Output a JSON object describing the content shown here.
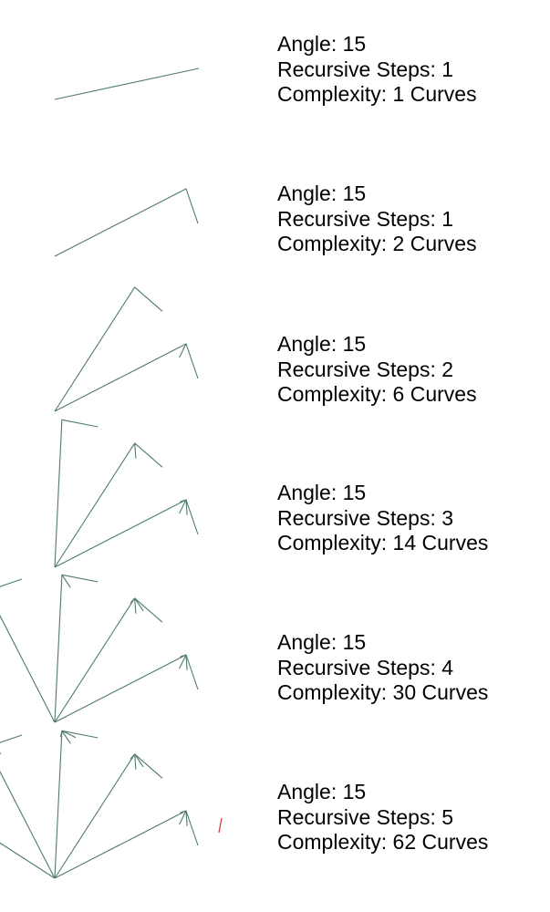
{
  "panels": [
    {
      "angle": "Angle: 15",
      "steps": "Recursive Steps: 1",
      "complexity": "Complexity: 1 Curves",
      "recursion_depth": 0
    },
    {
      "angle": "Angle: 15",
      "steps": "Recursive Steps: 1",
      "complexity": "Complexity: 2 Curves",
      "recursion_depth": 1
    },
    {
      "angle": "Angle: 15",
      "steps": "Recursive Steps: 2",
      "complexity": "Complexity: 6 Curves",
      "recursion_depth": 2
    },
    {
      "angle": "Angle: 15",
      "steps": "Recursive Steps: 3",
      "complexity": "Complexity: 14 Curves",
      "recursion_depth": 3
    },
    {
      "angle": "Angle: 15",
      "steps": "Recursive Steps: 4",
      "complexity": "Complexity: 30 Curves",
      "recursion_depth": 4
    },
    {
      "angle": "Angle: 15",
      "steps": "Recursive Steps: 5",
      "complexity": "Complexity: 62 Curves",
      "recursion_depth": 5
    }
  ],
  "colors": {
    "curve": "#4f7a6f",
    "highlight": "#d43a3a",
    "text": "#000000",
    "background": "#ffffff"
  }
}
